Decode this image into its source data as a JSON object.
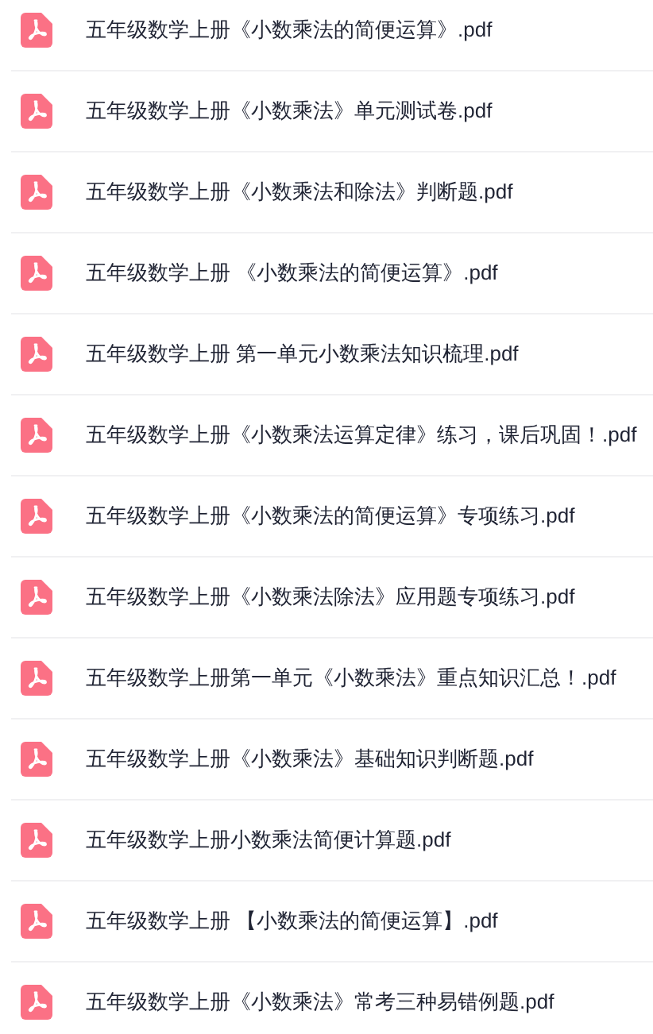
{
  "files": [
    {
      "name": "五年级数学上册《小数乘法的简便运算》.pdf"
    },
    {
      "name": "五年级数学上册《小数乘法》单元测试卷.pdf"
    },
    {
      "name": "五年级数学上册《小数乘法和除法》判断题.pdf"
    },
    {
      "name": "五年级数学上册 《小数乘法的简便运算》.pdf"
    },
    {
      "name": "五年级数学上册 第一单元小数乘法知识梳理.pdf"
    },
    {
      "name": "五年级数学上册《小数乘法运算定律》练习，课后巩固！.pdf"
    },
    {
      "name": "五年级数学上册《小数乘法的简便运算》专项练习.pdf"
    },
    {
      "name": "五年级数学上册《小数乘法除法》应用题专项练习.pdf"
    },
    {
      "name": "五年级数学上册第一单元《小数乘法》重点知识汇总！.pdf"
    },
    {
      "name": "五年级数学上册《小数乘法》基础知识判断题.pdf"
    },
    {
      "name": "五年级数学上册小数乘法简便计算题.pdf"
    },
    {
      "name": "五年级数学上册 【小数乘法的简便运算】.pdf"
    },
    {
      "name": "五年级数学上册《小数乘法》常考三种易错例题.pdf"
    }
  ]
}
